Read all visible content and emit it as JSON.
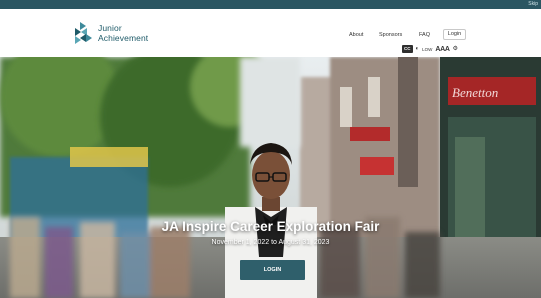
{
  "topbar": {
    "link_label": "Skip"
  },
  "brand": {
    "line1": "Junior",
    "line2": "Achievement"
  },
  "nav": {
    "items": [
      {
        "label": "About"
      },
      {
        "label": "Sponsors"
      },
      {
        "label": "FAQ"
      }
    ],
    "login_label": "Login"
  },
  "accessibility": {
    "cc_label": "CC",
    "mode_label": "LOW",
    "text_size_label": "AAA"
  },
  "hero": {
    "title": "JA Inspire Career Exploration Fair",
    "dates": "November 1, 2022 to August 31, 2023",
    "login_button": "LOGIN",
    "storefront_sign": "Benetton"
  },
  "colors": {
    "brand_teal": "#1e5a68",
    "topbar": "#2b5662",
    "login_button": "#2f5f6b"
  }
}
